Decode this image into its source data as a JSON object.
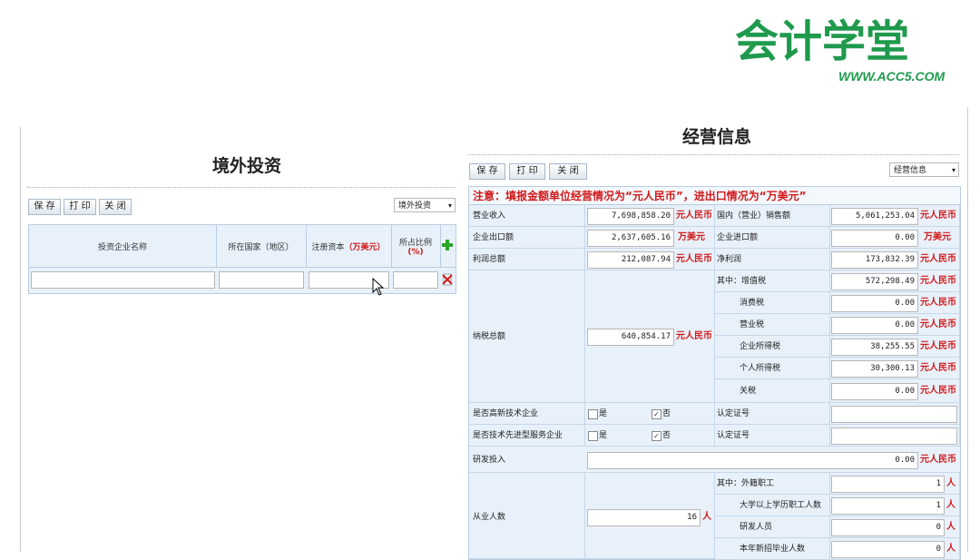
{
  "logo": {
    "main": "会计学堂",
    "url": "WWW.ACC5.COM"
  },
  "left": {
    "title": "境外投资",
    "toolbar": {
      "save": "保 存",
      "print": "打 印",
      "close": "关 闭",
      "select_value": "境外投资"
    },
    "columns": [
      "投资企业名称",
      "所在国家（地区）",
      "注册资本",
      "所占比例"
    ],
    "col_unit_capital": "（万美元）",
    "col_unit_ratio": "(%)"
  },
  "right": {
    "title": "经营信息",
    "toolbar": {
      "save": "保 存",
      "print": "打 印",
      "close": "关 闭",
      "select_value": "经营信息"
    },
    "notice": "注意：填报金额单位经营情况为“元人民币”，进出口情况为“万美元”",
    "rows": {
      "revenue": {
        "label": "营业收入",
        "value": "7,698,858.20",
        "unit": "元人民币"
      },
      "domestic_sales": {
        "label": "国内（营业）销售额",
        "value": "5,061,253.04",
        "unit": "元人民币"
      },
      "export": {
        "label": "企业出口额",
        "value": "2,637,605.16",
        "unit": "万美元"
      },
      "import": {
        "label": "企业进口额",
        "value": "0.00",
        "unit": "万美元"
      },
      "profit": {
        "label": "利润总额",
        "value": "212,087.94",
        "unit": "元人民币"
      },
      "net_profit": {
        "label": "净利润",
        "value": "173,832.39",
        "unit": "元人民币"
      },
      "tax_total": {
        "label": "纳税总额",
        "value": "640,854.17",
        "unit": "元人民币"
      },
      "vat": {
        "label": "其中：增值税",
        "value": "572,298.49",
        "unit": "元人民币"
      },
      "consumption": {
        "label": "消费税",
        "value": "0.00",
        "unit": "元人民币"
      },
      "business": {
        "label": "营业税",
        "value": "0.00",
        "unit": "元人民币"
      },
      "income": {
        "label": "企业所得税",
        "value": "38,255.55",
        "unit": "元人民币"
      },
      "personal": {
        "label": "个人所得税",
        "value": "30,300.13",
        "unit": "元人民币"
      },
      "customs": {
        "label": "关税",
        "value": "0.00",
        "unit": "元人民币"
      },
      "hightech": {
        "label": "是否高新技术企业",
        "yes": "是",
        "no": "否",
        "cert_label": "认定证号"
      },
      "advservice": {
        "label": "是否技术先进型服务企业",
        "yes": "是",
        "no": "否",
        "cert_label": "认定证号"
      },
      "rd": {
        "label": "研发投入",
        "value": "0.00",
        "unit": "元人民币"
      },
      "employees": {
        "label": "从业人数",
        "value": "16",
        "unit": "人"
      },
      "foreign_staff": {
        "label": "其中：外籍职工",
        "value": "1",
        "unit": "人"
      },
      "college": {
        "label": "大学以上学历职工人数",
        "value": "1",
        "unit": "人"
      },
      "rd_staff": {
        "label": "研发人员",
        "value": "0",
        "unit": "人"
      },
      "new_grads": {
        "label": "本年新招毕业人数",
        "value": "0",
        "unit": "人"
      }
    }
  }
}
